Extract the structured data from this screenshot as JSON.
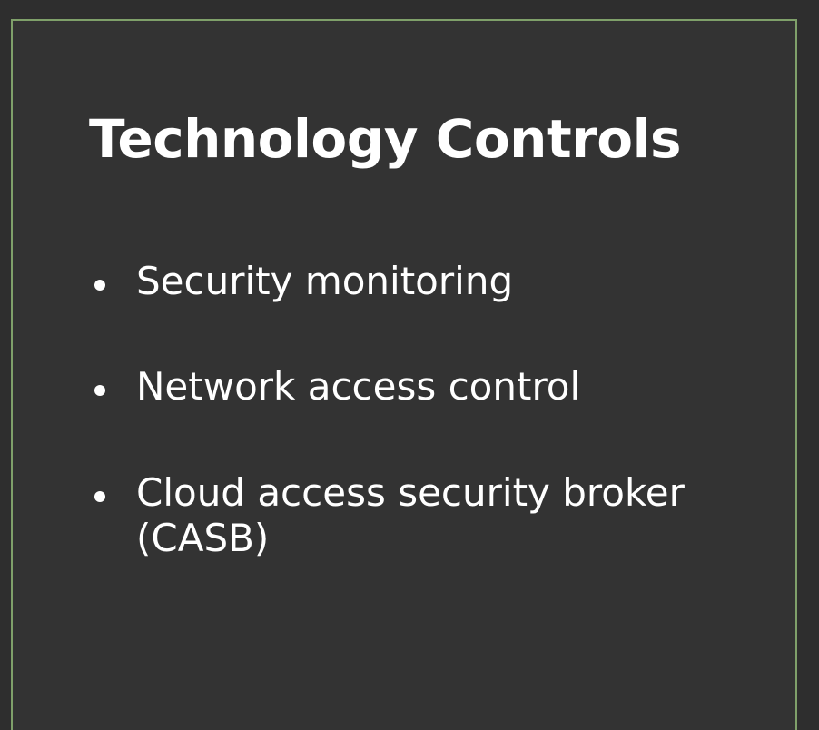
{
  "slide": {
    "title": "Technology Controls",
    "bullets": [
      {
        "text": "Security monitoring"
      },
      {
        "text": "Network access control"
      },
      {
        "text": "Cloud access security broker (CASB)"
      }
    ]
  },
  "colors": {
    "background": "#2e2e2e",
    "slide_background": "#333333",
    "frame_border": "#7fa06a",
    "text": "#ffffff"
  }
}
